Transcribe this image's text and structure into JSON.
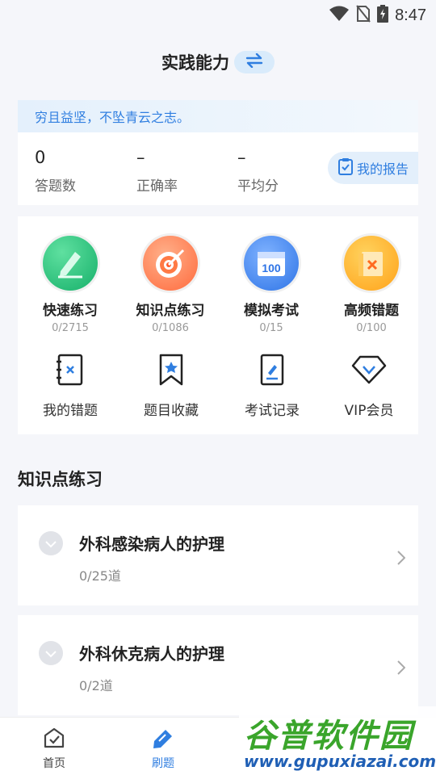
{
  "status": {
    "time": "8:47"
  },
  "header": {
    "title": "实践能力"
  },
  "stats": {
    "motto": "穷且益坚，不坠青云之志。",
    "items": [
      {
        "value": "0",
        "label": "答题数"
      },
      {
        "value": "–",
        "label": "正确率"
      },
      {
        "value": "–",
        "label": "平均分"
      }
    ],
    "report_label": "我的报告"
  },
  "features": [
    {
      "label": "快速练习",
      "count": "0/2715"
    },
    {
      "label": "知识点练习",
      "count": "0/1086"
    },
    {
      "label": "模拟考试",
      "count": "0/15",
      "badge": "100"
    },
    {
      "label": "高频错题",
      "count": "0/100"
    }
  ],
  "tools": [
    {
      "label": "我的错题"
    },
    {
      "label": "题目收藏"
    },
    {
      "label": "考试记录"
    },
    {
      "label": "VIP会员"
    }
  ],
  "section": {
    "title": "知识点练习"
  },
  "topics": [
    {
      "name": "外科感染病人的护理",
      "progress": "0/25道"
    },
    {
      "name": "外科休克病人的护理",
      "progress": "0/2道"
    }
  ],
  "tabs": [
    {
      "label": "首页"
    },
    {
      "label": "刷题"
    }
  ],
  "watermark": {
    "title": "谷普软件园",
    "url": "www.gupuxiazai.com"
  },
  "colors": {
    "accent": "#2f7ee0",
    "green": "#22b573",
    "orange": "#ff6a3d",
    "blue": "#2e74e6",
    "yellow": "#ffb21e"
  }
}
